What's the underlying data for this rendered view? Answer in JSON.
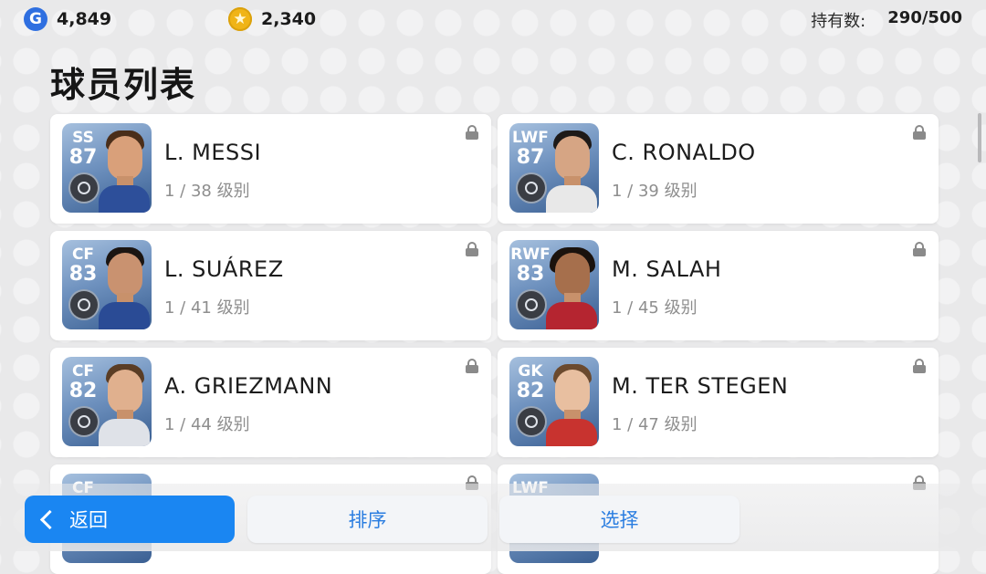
{
  "header": {
    "gp_icon": "G",
    "gp_amount": "4,849",
    "coin_icon": "★",
    "coin_amount": "2,340",
    "holding_label": "持有数:",
    "holding_value": "290/500"
  },
  "page_title": "球员列表",
  "players": [
    {
      "position": "SS",
      "rating": "87",
      "name": "L. MESSI",
      "level": "1 / 38 级别",
      "locked": true
    },
    {
      "position": "LWF",
      "rating": "87",
      "name": "C. RONALDO",
      "level": "1 / 39 级别",
      "locked": true
    },
    {
      "position": "CF",
      "rating": "83",
      "name": "L. SUÁREZ",
      "level": "1 / 41 级别",
      "locked": true
    },
    {
      "position": "RWF",
      "rating": "83",
      "name": "M. SALAH",
      "level": "1 / 45 级别",
      "locked": true
    },
    {
      "position": "CF",
      "rating": "82",
      "name": "A. GRIEZMANN",
      "level": "1 / 44 级别",
      "locked": true
    },
    {
      "position": "GK",
      "rating": "82",
      "name": "M. TER STEGEN",
      "level": "1 / 47 级别",
      "locked": true
    },
    {
      "position": "CF",
      "rating": "",
      "name": "",
      "level": "",
      "locked": true
    },
    {
      "position": "LWF",
      "rating": "",
      "name": "",
      "level": "",
      "locked": true
    }
  ],
  "footer": {
    "back_label": "返回",
    "sort_label": "排序",
    "select_label": "选择"
  },
  "colors": {
    "accent": "#1a86f2",
    "secondary_text": "#2a7de0",
    "card_thumb_blue": "#3a5f92"
  }
}
